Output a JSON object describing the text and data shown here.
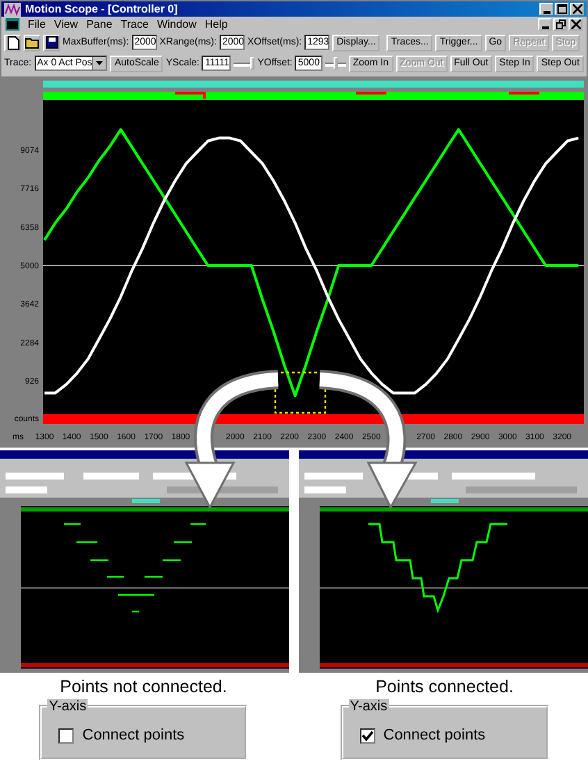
{
  "window": {
    "title": "Motion Scope - [Controller 0]"
  },
  "menu": [
    "File",
    "View",
    "Pane",
    "Trace",
    "Window",
    "Help"
  ],
  "toolbar": {
    "fields": [
      {
        "label": "MaxBuffer(ms):",
        "value": "2000"
      },
      {
        "label": "XRange(ms):",
        "value": "2000"
      },
      {
        "label": "XOffset(ms):",
        "value": "1293"
      }
    ],
    "buttons": [
      {
        "label": "Display...",
        "disabled": false
      },
      {
        "label": "Traces...",
        "disabled": false
      },
      {
        "label": "Trigger...",
        "disabled": false
      },
      {
        "label": "Go",
        "disabled": false
      },
      {
        "label": "Repeat",
        "disabled": true
      },
      {
        "label": "Stop",
        "disabled": true
      }
    ]
  },
  "trace_bar": {
    "trace_label": "Trace:",
    "trace_value": "Ax 0 Act Pos",
    "autoscale": "AutoScale",
    "sliders": [
      {
        "label": "YScale:",
        "value": "11111",
        "level": 1
      },
      {
        "label": "YOffset:",
        "value": "5000",
        "level": 0.5
      }
    ],
    "buttons": [
      {
        "label": "Zoom In",
        "disabled": false
      },
      {
        "label": "Zoom Out",
        "disabled": true
      },
      {
        "label": "Full Out",
        "disabled": false
      },
      {
        "label": "Step In",
        "disabled": false
      },
      {
        "label": "Step Out",
        "disabled": false
      }
    ]
  },
  "plot": {
    "chart_data": {
      "type": "line",
      "xlabel": "ms",
      "ylabel": "counts",
      "xlim": [
        1300,
        3280
      ],
      "ylim": [
        -252,
        10841
      ],
      "xticks": [
        1300,
        1400,
        1500,
        1600,
        1700,
        1800,
        2000,
        2100,
        2200,
        2300,
        2400,
        2500,
        2700,
        2800,
        2900,
        3000,
        3100,
        3200
      ],
      "yticks": [
        9074,
        7716,
        6358,
        5000,
        3642,
        2284,
        926
      ],
      "x": [
        1300,
        1340,
        1380,
        1420,
        1460,
        1500,
        1540,
        1580,
        1620,
        1660,
        1700,
        1740,
        1780,
        1820,
        1860,
        1900,
        1940,
        1980,
        2020,
        2060,
        2100,
        2140,
        2180,
        2220,
        2260,
        2300,
        2340,
        2380,
        2420,
        2460,
        2500,
        2540,
        2580,
        2620,
        2660,
        2700,
        2740,
        2780,
        2820,
        2860,
        2900,
        2940,
        2980,
        3020,
        3060,
        3100,
        3140,
        3180,
        3220,
        3260
      ],
      "series": [
        {
          "color": "#00ff00",
          "values": [
            5900,
            6500,
            7000,
            7600,
            8100,
            8700,
            9200,
            9800,
            9200,
            8600,
            8000,
            7400,
            6800,
            6200,
            5600,
            5000,
            5000,
            5000,
            5000,
            5000,
            3800,
            2700,
            1500,
            400,
            1500,
            2700,
            3800,
            5000,
            5000,
            5000,
            5000,
            5600,
            6200,
            6800,
            7400,
            8000,
            8600,
            9200,
            9800,
            9200,
            8600,
            8000,
            7400,
            6800,
            6200,
            5600,
            5000,
            5000,
            5000,
            5000
          ]
        },
        {
          "color": "#ffffff",
          "values": [
            500,
            500,
            800,
            1200,
            1700,
            2400,
            3100,
            3900,
            4800,
            5600,
            6500,
            7300,
            8000,
            8600,
            9000,
            9400,
            9500,
            9500,
            9400,
            9000,
            8600,
            8000,
            7300,
            6500,
            5600,
            4800,
            3900,
            3100,
            2400,
            1700,
            1200,
            800,
            500,
            500,
            500,
            800,
            1200,
            1700,
            2400,
            3100,
            3900,
            4800,
            5600,
            6500,
            7300,
            8000,
            8600,
            9000,
            9400,
            9500
          ]
        }
      ],
      "ref_lines": [
        {
          "axis": "y",
          "value": 5000
        }
      ]
    }
  },
  "examples": [
    {
      "caption": "Points not connected.",
      "group_title": "Y-axis",
      "checkbox_label": "Connect points",
      "checked": false
    },
    {
      "caption": "Points connected.",
      "group_title": "Y-axis",
      "checkbox_label": "Connect points",
      "checked": true
    }
  ]
}
